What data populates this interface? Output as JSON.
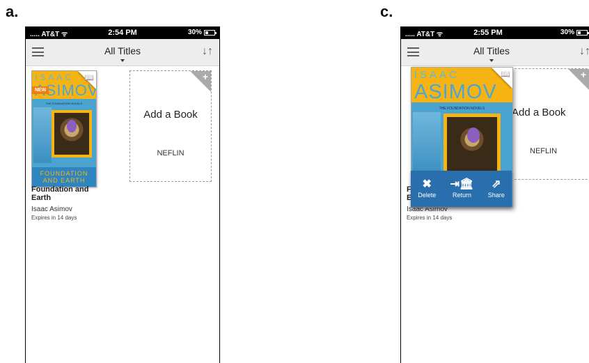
{
  "panels": [
    {
      "label": "a.",
      "status_bar": {
        "carrier": "AT&T",
        "time": "2:54 PM",
        "battery": "30%",
        "battery_level": 0.3
      },
      "nav": {
        "title": "All Titles"
      },
      "book": {
        "cover_top": "ISAAC",
        "cover_name": "ASIMOV",
        "cover_series": "THE FOUNDATION NOVELS",
        "cover_bottom_1": "FOUNDATION",
        "cover_bottom_2": "AND EARTH",
        "badge": "NEW",
        "title": "Foundation and Earth",
        "author": "Isaac Asimov",
        "expires": "Expires in 14 days"
      },
      "add_book": {
        "label": "Add a Book",
        "library": "NEFLIN"
      }
    },
    {
      "label": "c.",
      "status_bar": {
        "carrier": "AT&T",
        "time": "2:55 PM",
        "battery": "30%",
        "battery_level": 0.3
      },
      "nav": {
        "title": "All Titles"
      },
      "book": {
        "cover_top": "ISAAC",
        "cover_name": "ASIMOV",
        "cover_series": "THE FOUNDATION NOVELS",
        "title_initials": "F\nE",
        "author": "Isaac Asimov",
        "expires": "Expires in 14 days"
      },
      "add_book": {
        "label": "Add a Book",
        "library": "NEFLIN"
      },
      "actions": [
        {
          "label": "Delete",
          "icon": "delete-icon"
        },
        {
          "label": "Return",
          "icon": "return-library-icon"
        },
        {
          "label": "Share",
          "icon": "share-icon"
        }
      ]
    }
  ],
  "colors": {
    "accent_blue": "#2a6fad",
    "badge_orange": "#f07f12",
    "cover_yellow": "#f5b414",
    "navbar": "#ededed"
  }
}
